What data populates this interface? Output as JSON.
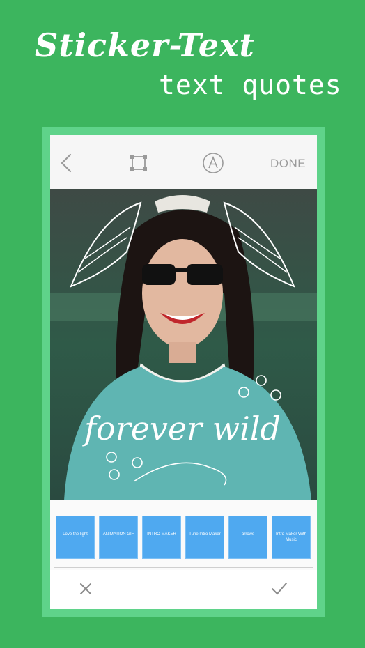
{
  "headline": {
    "title": "Sticker-Text",
    "subtitle": "text quotes"
  },
  "toolbar": {
    "back_icon": "chevron-left-icon",
    "crop_icon": "crop-frame-icon",
    "font_icon": "circled-a-icon",
    "done_label": "DONE"
  },
  "photo": {
    "overlay_text": "forever wild"
  },
  "stickers": [
    {
      "label": "Love the light"
    },
    {
      "label": "ANIMATION GIF"
    },
    {
      "label": "INTRO MAKER"
    },
    {
      "label": "Tune Intro Maker"
    },
    {
      "label": "arrows"
    },
    {
      "label": "Intro Maker With Music"
    }
  ],
  "bottom": {
    "cancel_icon": "close-icon",
    "confirm_icon": "checkmark-icon"
  },
  "colors": {
    "background": "#3cb55e",
    "frame": "#5fd38a",
    "sticker": "#4fa9f0"
  }
}
